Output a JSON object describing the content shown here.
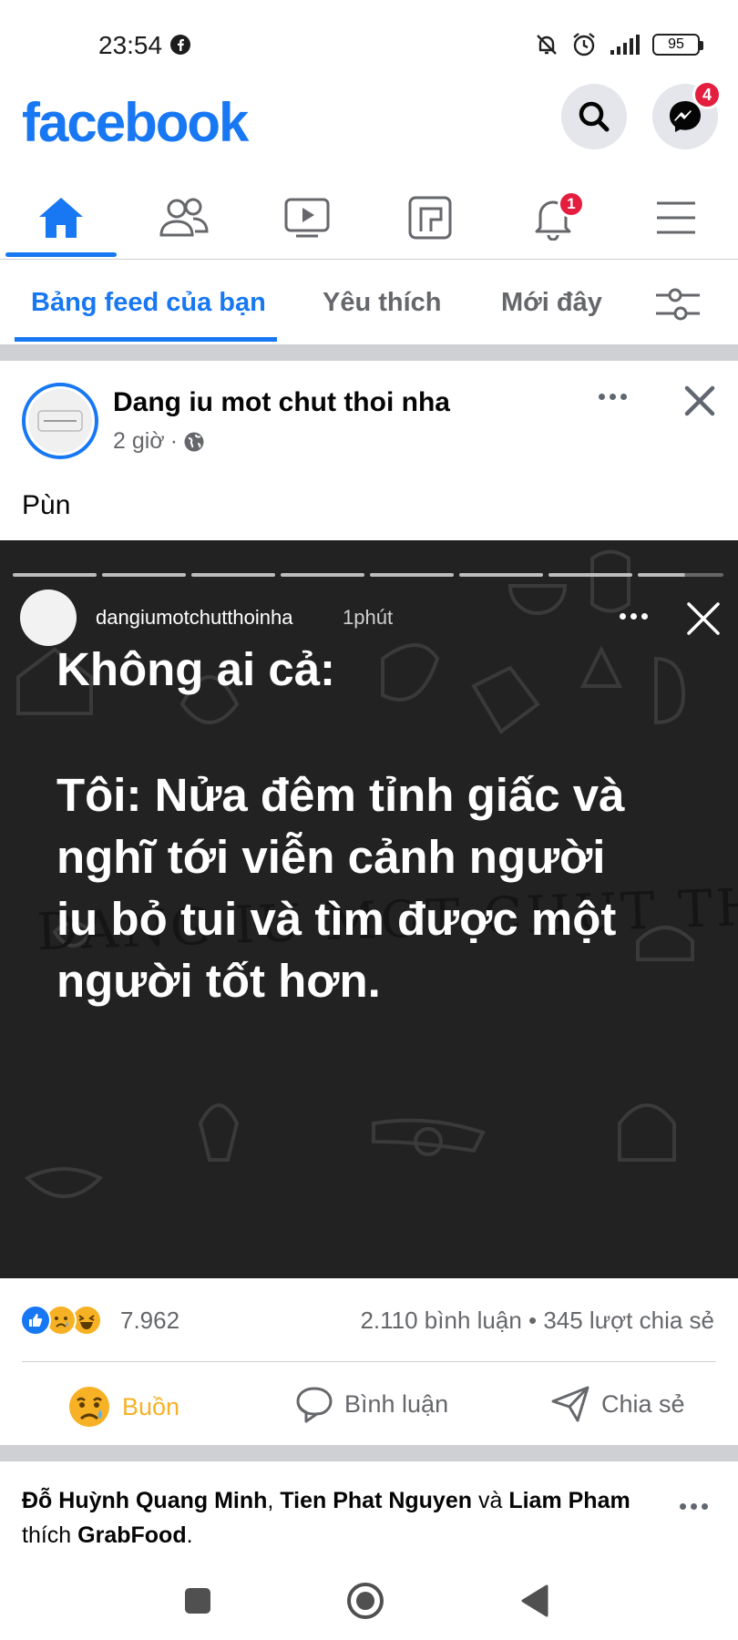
{
  "status_bar": {
    "time": "23:54",
    "battery": "95"
  },
  "header": {
    "logo": "facebook",
    "messenger_badge": "4"
  },
  "nav": {
    "notifications_badge": "1"
  },
  "feed_tabs": {
    "items": [
      "Bảng feed của bạn",
      "Yêu thích",
      "Mới đây"
    ]
  },
  "post": {
    "author": "Dang iu mot chut thoi nha",
    "time": "2 giờ",
    "separator": "·",
    "text": "Pùn",
    "story": {
      "username": "dangiumotchutthoinha",
      "time": "1phút",
      "lines": [
        "Không ai cả:",
        "Tôi: Nửa đêm tỉnh giấc và",
        "nghĩ tới viễn cảnh người",
        "iu bỏ tui và tìm được một",
        "người tốt hơn."
      ],
      "watermark": "DANG IU MOT CHUT THOI NHA"
    },
    "reaction_count": "7.962",
    "comments_shares": "2.110 bình luận • 345 lượt chia sẻ",
    "actions": {
      "sad": "Buồn",
      "comment": "Bình luận",
      "share": "Chia sẻ"
    }
  },
  "liked": {
    "name1": "Đỗ Huỳnh Quang Minh",
    "comma": ",",
    "name2": "Tien Phat Nguyen",
    "and": "và",
    "name3": "Liam Pham",
    "liked_word": "thích",
    "page": "GrabFood",
    "period": "."
  },
  "colors": {
    "brand": "#1877f2",
    "badge": "#e41e3f",
    "sad": "#f7b125"
  }
}
